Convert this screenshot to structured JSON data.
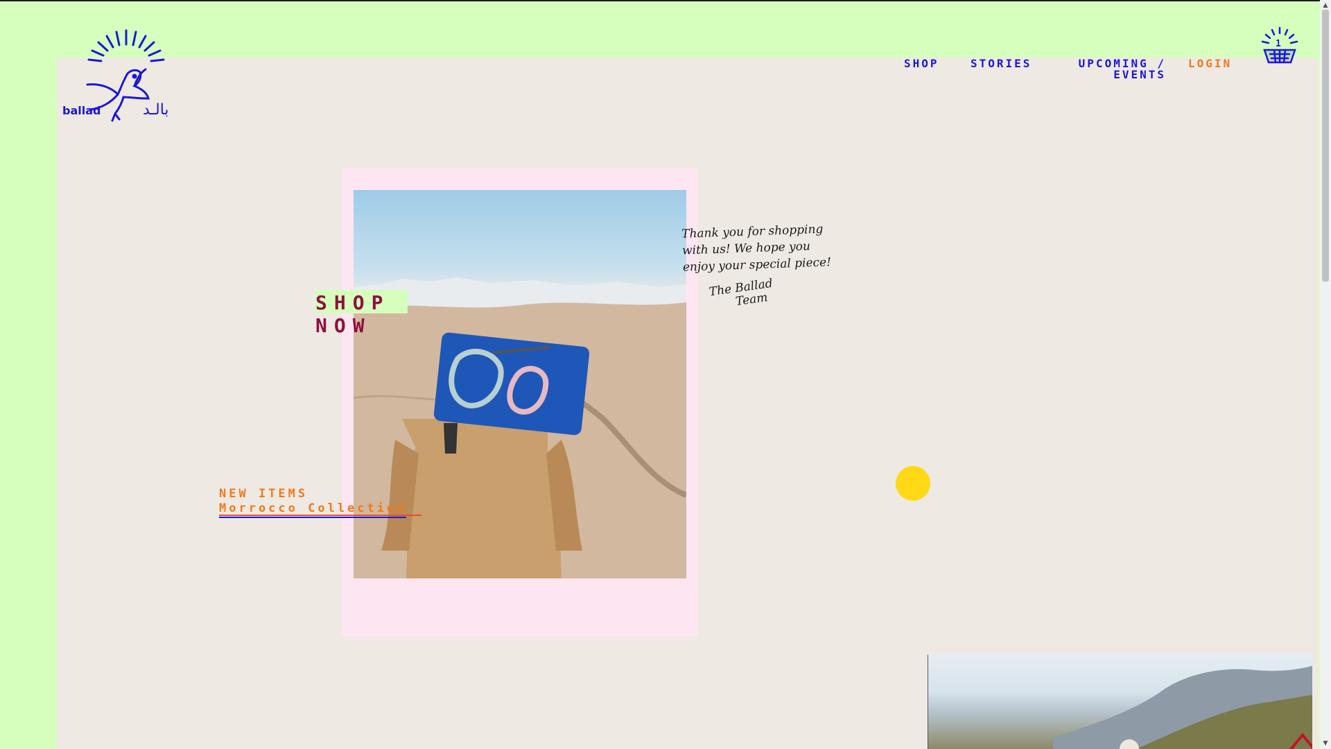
{
  "brand": {
    "name_en": "ballad",
    "name_ar": "بالـد"
  },
  "nav": {
    "items": [
      {
        "label": "SHOP"
      },
      {
        "label": "STORIES"
      },
      {
        "label_line1": "UPCOMING /",
        "label_line2": "EVENTS"
      },
      {
        "label": "LOGIN"
      }
    ],
    "cart_count": "1"
  },
  "hero": {
    "shop_now_line1": "SHOP",
    "shop_now_line2": "NOW",
    "new_items": "NEW ITEMS",
    "collection": "Morrocco Collection",
    "note_line1": "Thank you for shopping",
    "note_line2": "with us! We hope you",
    "note_line3": "enjoy your special piece!",
    "sign_line1": "The Ballad",
    "sign_line2": "Team"
  },
  "colors": {
    "page_bg": "#d6ffbe",
    "panel_bg": "#efe9e4",
    "brand_blue": "#1a17d6",
    "accent_orange": "#f07a1a",
    "shop_now": "#8f1040",
    "frame_pink": "#fde6f2",
    "dot_yellow": "#ffd916"
  },
  "icons": {
    "logo": "dove-with-sunrays-icon",
    "cart": "basket-with-sunrays-icon"
  }
}
